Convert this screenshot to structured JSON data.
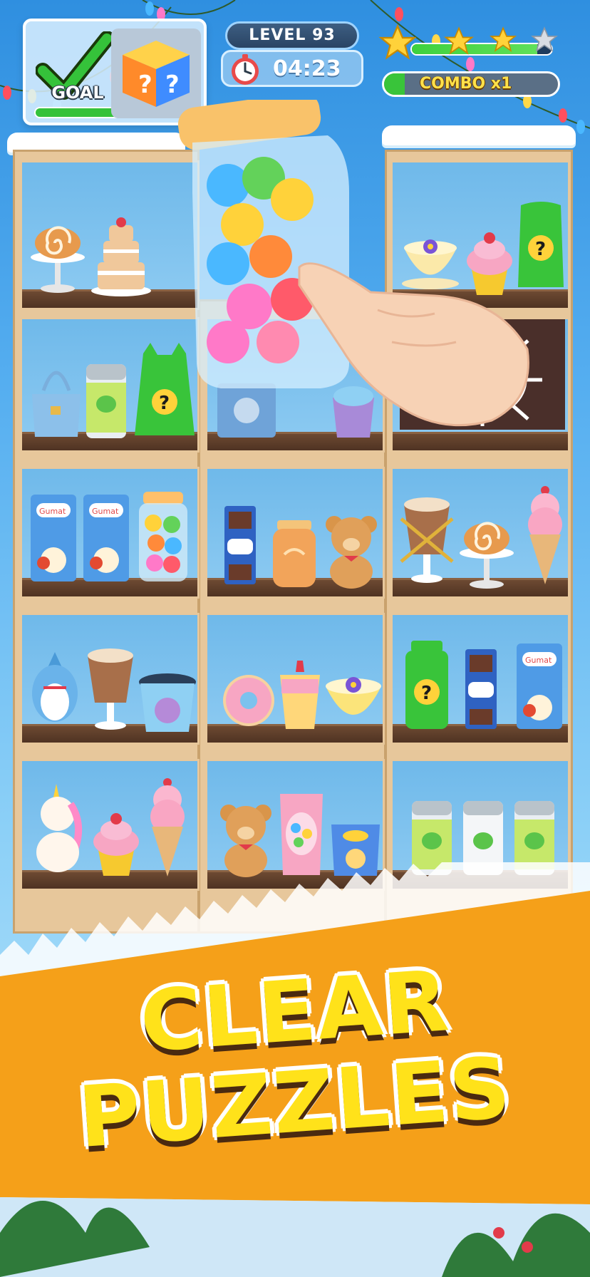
{
  "hud": {
    "goal_label": "GOAL",
    "goal_progress": 1.0,
    "level_label": "LEVEL 93",
    "timer": "04:23",
    "stars_earned": 3,
    "stars_total": 4,
    "star_progress": 0.9,
    "combo_label": "COMBO x1",
    "combo_progress": 0.12
  },
  "colors": {
    "sky_top": "#2f8fe0",
    "wood": "#e7c79b",
    "ledge": "#5a3b27",
    "cell_bg": "#7cc2ee",
    "banner_orange": "#f5a019",
    "headline_yellow": "#ffe21a",
    "mystery_green": "#39c43a"
  },
  "shelves": {
    "rows": [
      {
        "row": 1,
        "left": [
          "cinnamon-roll-stand",
          "layered-cake"
        ],
        "middle": [
          "jelly-jar-held"
        ],
        "right": [
          "tea-cup-flower",
          "cupcake",
          "mystery-item"
        ]
      },
      {
        "row": 2,
        "left": [
          "blue-handbag",
          "green-soda-can",
          "mystery-item"
        ],
        "middle": [
          "locked-box",
          "ice-cream-tub"
        ],
        "right": [
          "spider-web-block"
        ]
      },
      {
        "row": 3,
        "left": [
          "gumat-pudding-pack",
          "gumat-pudding-pack",
          "jelly-jar"
        ],
        "middle": [
          "hk-chocolate-bar",
          "honey-jar",
          "teddy-bear"
        ],
        "right": [
          "latte-cup-chained",
          "cinnamon-roll-stand",
          "ice-cream-cone"
        ]
      },
      {
        "row": 4,
        "left": [
          "shark-plush",
          "latte-cup",
          "ice-cream-tub"
        ],
        "middle": [
          "pink-donut",
          "berry-parfait",
          "tea-cup-flower"
        ],
        "right": [
          "mystery-jar",
          "hk-chocolate-bar",
          "gumat-pudding-pack"
        ]
      },
      {
        "row": 5,
        "left": [
          "unicorn-plush",
          "cupcake",
          "ice-cream-cone"
        ],
        "middle": [
          "teddy-bear",
          "candy-bag",
          "chips-bag"
        ],
        "right": [
          "green-soda-can",
          "green-soda-can",
          "green-soda-can"
        ]
      }
    ],
    "mystery_mark": "?"
  },
  "banner": {
    "line1": "CLEAR",
    "line2": "PUZZLES"
  },
  "icons": {
    "goal": "checkmark-icon",
    "mystery": "mystery-cube-icon",
    "timer": "stopwatch-icon",
    "star": "star-icon",
    "hand": "pointing-hand-icon"
  }
}
